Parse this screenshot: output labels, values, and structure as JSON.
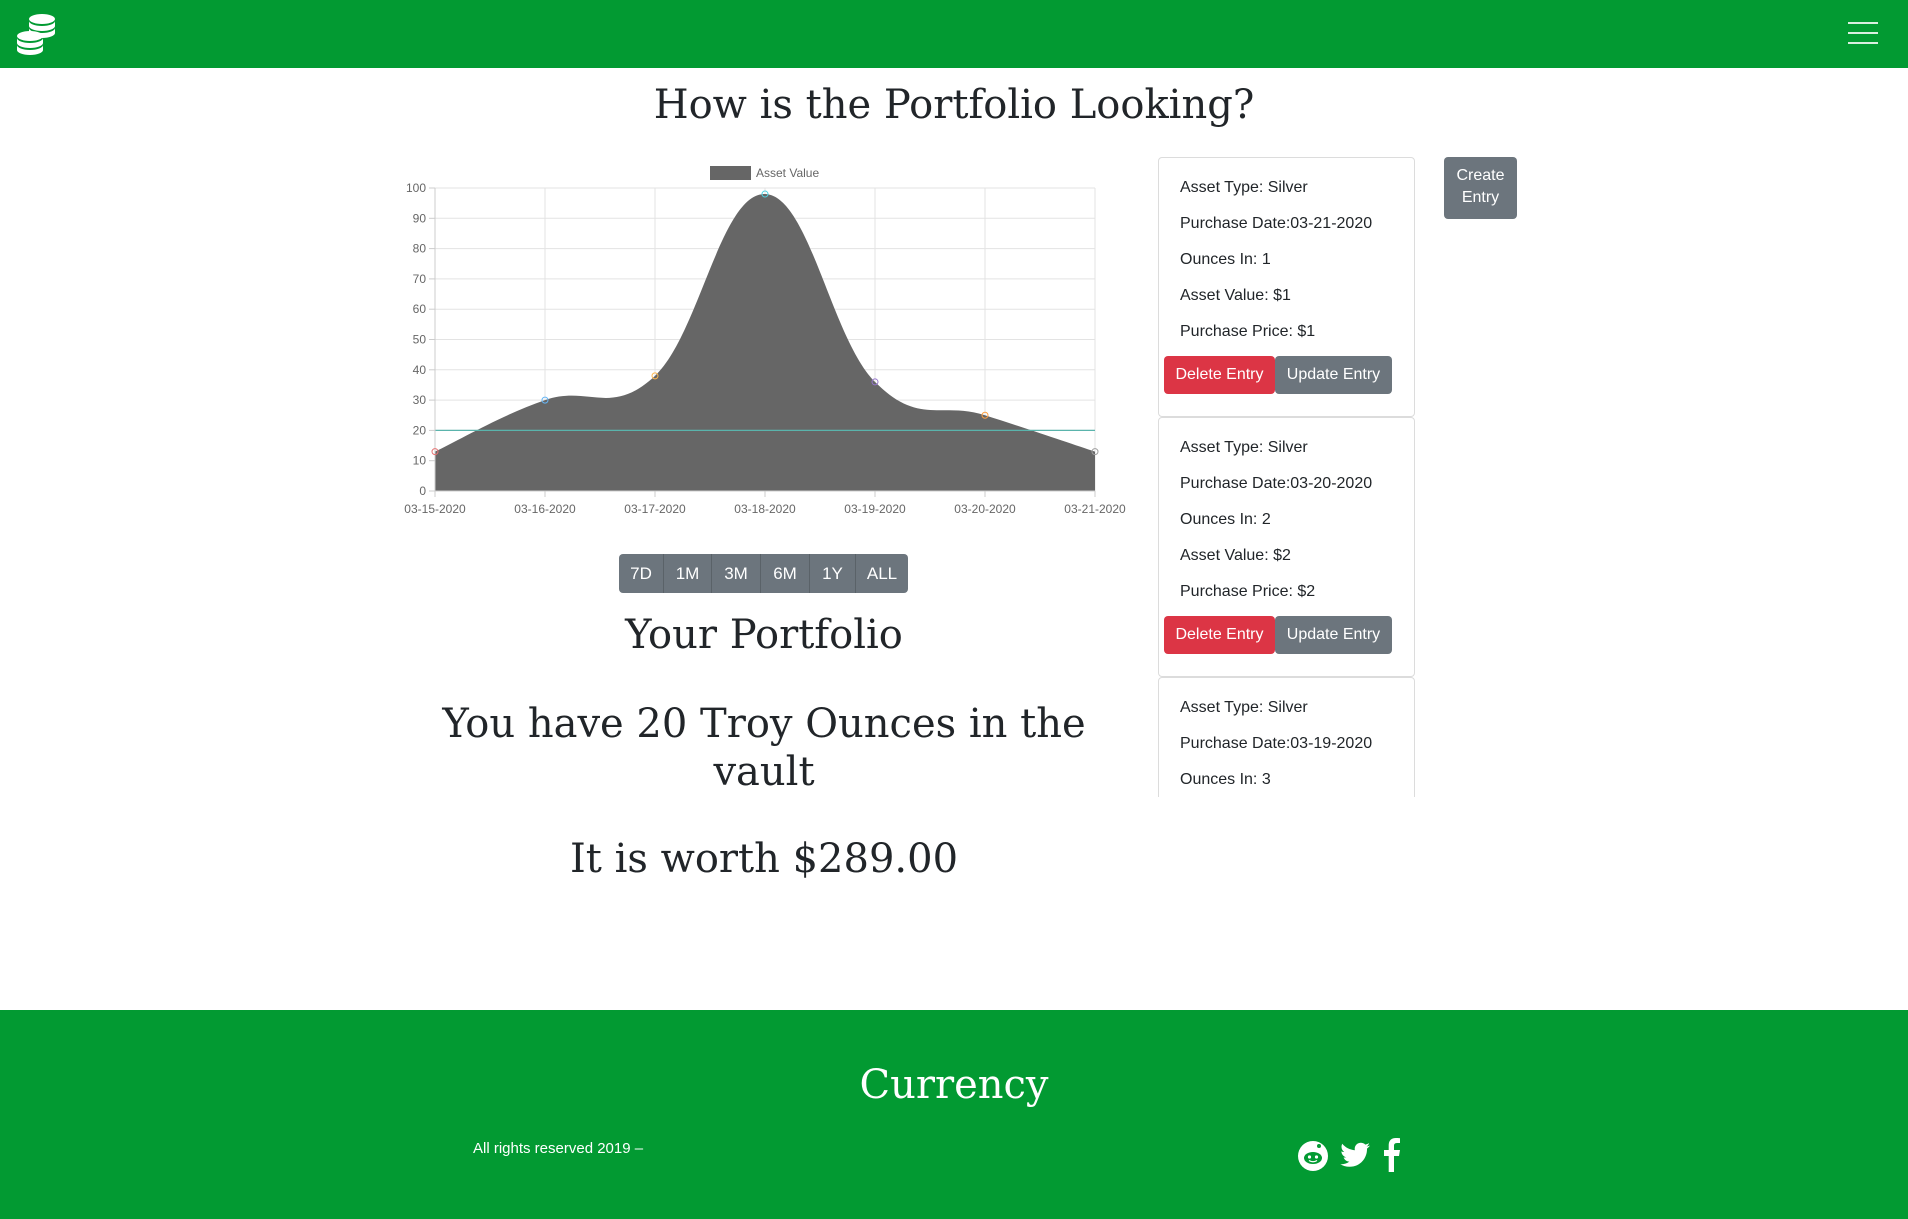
{
  "header": {
    "logo_icon": "coins-stack-icon",
    "menu_icon": "hamburger-menu-icon",
    "brand_color": "#029a32"
  },
  "page_title": "How is the Portfolio Looking?",
  "chart_data": {
    "type": "area",
    "legend": [
      "Asset Value"
    ],
    "legend_placement": "top",
    "x": [
      "03-15-2020",
      "03-16-2020",
      "03-17-2020",
      "03-18-2020",
      "03-19-2020",
      "03-20-2020",
      "03-21-2020"
    ],
    "series": [
      {
        "name": "Asset Value",
        "values": [
          13,
          30,
          38,
          98,
          36,
          25,
          13
        ],
        "color": "#666666"
      }
    ],
    "reference_line": {
      "value": 20,
      "color": "#5ab4ac"
    },
    "point_colors": [
      "#e57373",
      "#64b5f6",
      "#ffb74d",
      "#4dd0e1",
      "#9575cd",
      "#ff9f40",
      "#9e9e9e"
    ],
    "yticks": [
      "0",
      "10",
      "20",
      "30",
      "40",
      "50",
      "60",
      "70",
      "80",
      "90",
      "100"
    ],
    "ylim": [
      0,
      100
    ],
    "grid": true
  },
  "range_buttons": [
    "7D",
    "1M",
    "3M",
    "6M",
    "1Y",
    "ALL"
  ],
  "portfolio": {
    "title": "Your Portfolio",
    "ounces_text": "You have 20 Troy Ounces in the vault",
    "worth_text": "It is worth $289.00"
  },
  "entries": [
    {
      "type": "Asset Type: Silver",
      "date": "Purchase Date:03-21-2020",
      "ounces": "Ounces In: 1",
      "value": "Asset Value: $1",
      "price": "Purchase Price: $1",
      "delete_label": "Delete Entry",
      "update_label": "Update Entry"
    },
    {
      "type": "Asset Type: Silver",
      "date": "Purchase Date:03-20-2020",
      "ounces": "Ounces In: 2",
      "value": "Asset Value: $2",
      "price": "Purchase Price: $2",
      "delete_label": "Delete Entry",
      "update_label": "Update Entry"
    },
    {
      "type": "Asset Type: Silver",
      "date": "Purchase Date:03-19-2020",
      "ounces": "Ounces In: 3",
      "value": "",
      "price": "",
      "delete_label": "",
      "update_label": ""
    }
  ],
  "create_label_line1": "Create",
  "create_label_line2": "Entry",
  "footer": {
    "brand": "Currency",
    "copyright": "All rights reserved 2019 –",
    "social_icons": [
      "reddit-icon",
      "twitter-icon",
      "facebook-icon"
    ]
  }
}
